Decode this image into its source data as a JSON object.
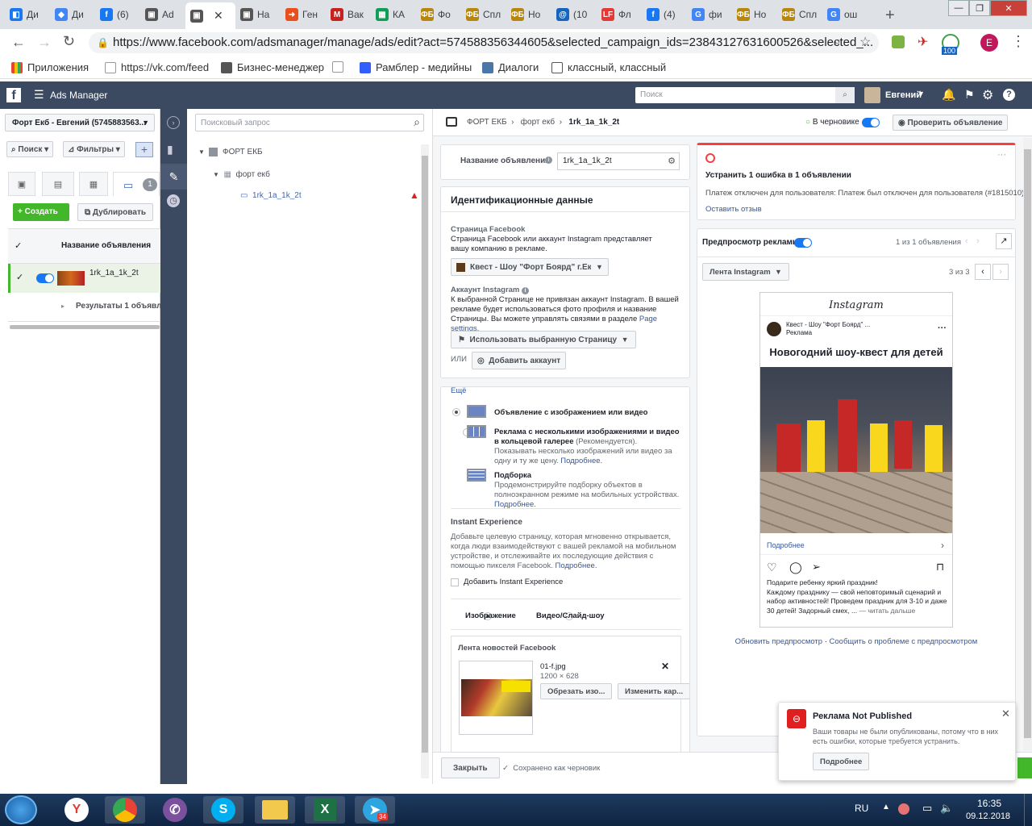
{
  "browser": {
    "tabs": [
      {
        "label": "Ди",
        "color": "#1877f2",
        "glyph": "◧"
      },
      {
        "label": "Ди",
        "color": "#4285f4",
        "glyph": "◆"
      },
      {
        "label": "(6)",
        "color": "#1877f2",
        "glyph": "f"
      },
      {
        "label": "Ad",
        "color": "#555",
        "glyph": "▣"
      },
      {
        "label": "",
        "color": "#555",
        "glyph": "▣"
      },
      {
        "label": "Нa",
        "color": "#555",
        "glyph": "▣"
      },
      {
        "label": "Ген",
        "color": "#e94e1b",
        "glyph": "➜"
      },
      {
        "label": "Вак",
        "color": "#c5221f",
        "glyph": "M"
      },
      {
        "label": "КА",
        "color": "#0f9d58",
        "glyph": "▦"
      },
      {
        "label": "Фо",
        "color": "#b8860b",
        "glyph": "ФБ"
      },
      {
        "label": "Спл",
        "color": "#b8860b",
        "glyph": "ФБ"
      },
      {
        "label": "Но",
        "color": "#b8860b",
        "glyph": "ФБ"
      },
      {
        "label": "(10",
        "color": "#1565c0",
        "glyph": "@"
      },
      {
        "label": "Фл",
        "color": "#e53935",
        "glyph": "LF"
      },
      {
        "label": "(4)",
        "color": "#1877f2",
        "glyph": "f"
      },
      {
        "label": "фи",
        "color": "#4285f4",
        "glyph": "G"
      },
      {
        "label": "Но",
        "color": "#b8860b",
        "glyph": "ФБ"
      },
      {
        "label": "Спл",
        "color": "#b8860b",
        "glyph": "ФБ"
      },
      {
        "label": "ош",
        "color": "#4285f4",
        "glyph": "G"
      }
    ],
    "url": "https://www.facebook.com/adsmanager/manage/ads/edit?act=574588356344605&selected_campaign_ids=23843127631600526&selected_...",
    "bookmarks": [
      "Приложения",
      "https://vk.com/feed",
      "Бизнес-менеджер",
      "",
      "Рамблер - медийны",
      "Диалоги",
      "классный, классный"
    ],
    "ext_badge": "100",
    "avatar_letter": "E"
  },
  "fb": {
    "app_title": "Ads Manager",
    "search_placeholder": "Поиск",
    "user_name": "Евгений"
  },
  "left": {
    "account": "Форт Екб - Евгений (5745883563...",
    "search_btn": "Поиск",
    "filters_btn": "Фильтры",
    "tab_badge": "1",
    "create_btn": "Создать",
    "duplicate_btn": "Дублировать",
    "col_header": "Название объявления",
    "row_name": "1rk_1a_1k_2t",
    "results": "Результаты 1 объявлен"
  },
  "tree": {
    "search_placeholder": "Поисковый запрос",
    "campaign": "ФОРТ ЕКБ",
    "adset": "форт екб",
    "ad": "1rk_1a_1k_2t"
  },
  "editor": {
    "breadcrumb": [
      "ФОРТ ЕКБ",
      "форт екб",
      "1rk_1a_1k_2t"
    ],
    "draft_label": "В черновике",
    "check_btn": "Проверить объявление",
    "ad_name_label": "Название объявления",
    "ad_name_value": "1rk_1a_1k_2t",
    "identity_title": "Идентификационные данные",
    "fb_page_label": "Страница Facebook",
    "fb_page_desc": "Страница Facebook или аккаунт Instagram представляет вашу компанию в рекламе.",
    "fb_page_value": "Квест - Шоу \"Форт Боярд\" г.Ек...",
    "ig_label": "Аккаунт Instagram",
    "ig_desc": "К выбранной Странице не привязан аккаунт Instagram. В вашей рекламе будет использоваться фото профиля и название Страницы. Вы можете управлять связями в разделе",
    "ig_link": "Page settings.",
    "use_page_btn": "Использовать выбранную Страницу",
    "or_label": "ИЛИ",
    "add_account_btn": "Добавить аккаунт",
    "more_label": "Ещё",
    "format_single": "Объявление с изображением или видео",
    "format_carousel": "Реклама с несколькими изображениями и видео в кольцевой галерее",
    "format_carousel_rec": "(Рекомендуется).",
    "format_carousel_desc": "Показывать несколько изображений или видео за одну и ту же цену.",
    "more_link": "Подробнее.",
    "format_collection": "Подборка",
    "format_collection_desc": "Продемонстрируйте подборку объектов в полноэкранном режиме на мобильных устройствах.",
    "instant_title": "Instant Experience",
    "instant_desc": "Добавьте целевую страницу, которая мгновенно открывается, когда люди взаимодействуют с вашей рекламой на мобильном устройстве, и отслеживайте их последующие действия с помощью пикселя Facebook.",
    "add_instant": "Добавить Instant Experience",
    "media_image": "Изображение",
    "media_video": "Видео/Слайд-шоу",
    "feed_title": "Лента новостей Facebook",
    "file_name": "01-f.jpg",
    "file_dims": "1200 × 628",
    "crop_btn": "Обрезать изо...",
    "change_btn": "Изменить кар...",
    "close_btn": "Закрыть",
    "saved_label": "Сохранено как черновик"
  },
  "errors": {
    "title": "Устранить 1 ошибка в 1 объявлении",
    "message": "Платеж отключен для пользователя: Платеж был отключен для пользователя (#1815010)",
    "feedback": "Оставить отзыв"
  },
  "preview": {
    "label": "Предпросмотр рекламы",
    "count": "1 из 1 объявления",
    "placement": "Лента Instagram",
    "page_count": "3 из 3",
    "ig_logo": "Instagram",
    "page_name": "Квест - Шоу \"Форт Боярд\" ...",
    "sponsored": "Реклама",
    "headline": "Новогодний шоу-квест для детей",
    "learn_more": "Подробнее",
    "caption_bold": "Подарите ребенку яркий праздник!",
    "caption": "Каждому празднику — свой неповторимый сценарий и набор активностей! Проведем праздник для 3-10 и даже 30 детей! Задорный смех, ...",
    "read_more": "— читать дальше",
    "refresh_link": "Обновить предпросмотр",
    "report_link": "Сообщить о проблеме с предпросмотром"
  },
  "toast": {
    "title": "Реклама Not Published",
    "body": "Ваши товары не были опубликованы, потому что в них есть ошибки, которые требуется устранить.",
    "btn": "Подробнее"
  },
  "taskbar": {
    "lang": "RU",
    "time": "16:35",
    "date": "09.12.2018",
    "telegram_badge": "34"
  }
}
